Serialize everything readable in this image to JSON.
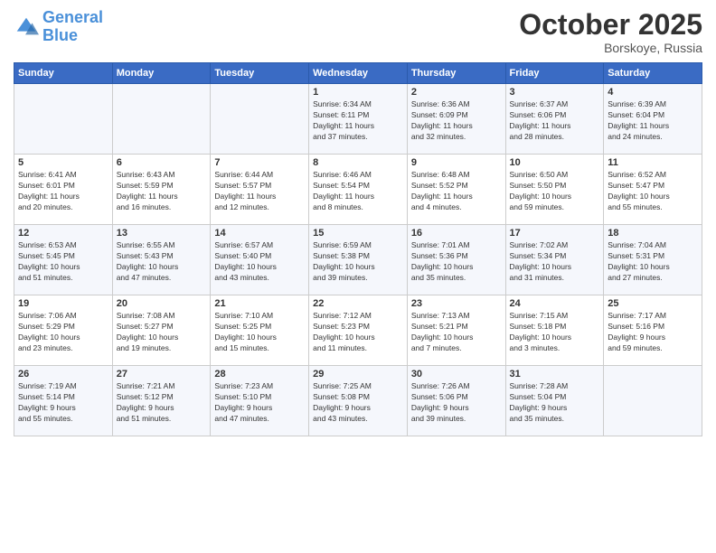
{
  "header": {
    "logo_line1": "General",
    "logo_line2": "Blue",
    "month": "October 2025",
    "location": "Borskoye, Russia"
  },
  "days_of_week": [
    "Sunday",
    "Monday",
    "Tuesday",
    "Wednesday",
    "Thursday",
    "Friday",
    "Saturday"
  ],
  "weeks": [
    [
      {
        "day": "",
        "info": ""
      },
      {
        "day": "",
        "info": ""
      },
      {
        "day": "",
        "info": ""
      },
      {
        "day": "1",
        "info": "Sunrise: 6:34 AM\nSunset: 6:11 PM\nDaylight: 11 hours\nand 37 minutes."
      },
      {
        "day": "2",
        "info": "Sunrise: 6:36 AM\nSunset: 6:09 PM\nDaylight: 11 hours\nand 32 minutes."
      },
      {
        "day": "3",
        "info": "Sunrise: 6:37 AM\nSunset: 6:06 PM\nDaylight: 11 hours\nand 28 minutes."
      },
      {
        "day": "4",
        "info": "Sunrise: 6:39 AM\nSunset: 6:04 PM\nDaylight: 11 hours\nand 24 minutes."
      }
    ],
    [
      {
        "day": "5",
        "info": "Sunrise: 6:41 AM\nSunset: 6:01 PM\nDaylight: 11 hours\nand 20 minutes."
      },
      {
        "day": "6",
        "info": "Sunrise: 6:43 AM\nSunset: 5:59 PM\nDaylight: 11 hours\nand 16 minutes."
      },
      {
        "day": "7",
        "info": "Sunrise: 6:44 AM\nSunset: 5:57 PM\nDaylight: 11 hours\nand 12 minutes."
      },
      {
        "day": "8",
        "info": "Sunrise: 6:46 AM\nSunset: 5:54 PM\nDaylight: 11 hours\nand 8 minutes."
      },
      {
        "day": "9",
        "info": "Sunrise: 6:48 AM\nSunset: 5:52 PM\nDaylight: 11 hours\nand 4 minutes."
      },
      {
        "day": "10",
        "info": "Sunrise: 6:50 AM\nSunset: 5:50 PM\nDaylight: 10 hours\nand 59 minutes."
      },
      {
        "day": "11",
        "info": "Sunrise: 6:52 AM\nSunset: 5:47 PM\nDaylight: 10 hours\nand 55 minutes."
      }
    ],
    [
      {
        "day": "12",
        "info": "Sunrise: 6:53 AM\nSunset: 5:45 PM\nDaylight: 10 hours\nand 51 minutes."
      },
      {
        "day": "13",
        "info": "Sunrise: 6:55 AM\nSunset: 5:43 PM\nDaylight: 10 hours\nand 47 minutes."
      },
      {
        "day": "14",
        "info": "Sunrise: 6:57 AM\nSunset: 5:40 PM\nDaylight: 10 hours\nand 43 minutes."
      },
      {
        "day": "15",
        "info": "Sunrise: 6:59 AM\nSunset: 5:38 PM\nDaylight: 10 hours\nand 39 minutes."
      },
      {
        "day": "16",
        "info": "Sunrise: 7:01 AM\nSunset: 5:36 PM\nDaylight: 10 hours\nand 35 minutes."
      },
      {
        "day": "17",
        "info": "Sunrise: 7:02 AM\nSunset: 5:34 PM\nDaylight: 10 hours\nand 31 minutes."
      },
      {
        "day": "18",
        "info": "Sunrise: 7:04 AM\nSunset: 5:31 PM\nDaylight: 10 hours\nand 27 minutes."
      }
    ],
    [
      {
        "day": "19",
        "info": "Sunrise: 7:06 AM\nSunset: 5:29 PM\nDaylight: 10 hours\nand 23 minutes."
      },
      {
        "day": "20",
        "info": "Sunrise: 7:08 AM\nSunset: 5:27 PM\nDaylight: 10 hours\nand 19 minutes."
      },
      {
        "day": "21",
        "info": "Sunrise: 7:10 AM\nSunset: 5:25 PM\nDaylight: 10 hours\nand 15 minutes."
      },
      {
        "day": "22",
        "info": "Sunrise: 7:12 AM\nSunset: 5:23 PM\nDaylight: 10 hours\nand 11 minutes."
      },
      {
        "day": "23",
        "info": "Sunrise: 7:13 AM\nSunset: 5:21 PM\nDaylight: 10 hours\nand 7 minutes."
      },
      {
        "day": "24",
        "info": "Sunrise: 7:15 AM\nSunset: 5:18 PM\nDaylight: 10 hours\nand 3 minutes."
      },
      {
        "day": "25",
        "info": "Sunrise: 7:17 AM\nSunset: 5:16 PM\nDaylight: 9 hours\nand 59 minutes."
      }
    ],
    [
      {
        "day": "26",
        "info": "Sunrise: 7:19 AM\nSunset: 5:14 PM\nDaylight: 9 hours\nand 55 minutes."
      },
      {
        "day": "27",
        "info": "Sunrise: 7:21 AM\nSunset: 5:12 PM\nDaylight: 9 hours\nand 51 minutes."
      },
      {
        "day": "28",
        "info": "Sunrise: 7:23 AM\nSunset: 5:10 PM\nDaylight: 9 hours\nand 47 minutes."
      },
      {
        "day": "29",
        "info": "Sunrise: 7:25 AM\nSunset: 5:08 PM\nDaylight: 9 hours\nand 43 minutes."
      },
      {
        "day": "30",
        "info": "Sunrise: 7:26 AM\nSunset: 5:06 PM\nDaylight: 9 hours\nand 39 minutes."
      },
      {
        "day": "31",
        "info": "Sunrise: 7:28 AM\nSunset: 5:04 PM\nDaylight: 9 hours\nand 35 minutes."
      },
      {
        "day": "",
        "info": ""
      }
    ]
  ]
}
